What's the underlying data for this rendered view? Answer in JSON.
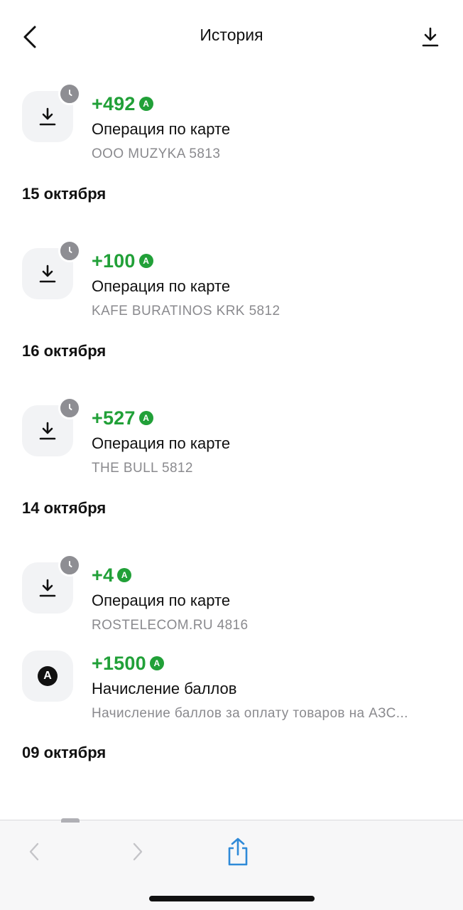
{
  "header": {
    "title": "История"
  },
  "transactions": [
    {
      "amount": "+492",
      "badge": "A",
      "title": "Операция по карте",
      "subtitle": "ООО MUZYKA 5813",
      "icon": "download-icon",
      "pending": true
    },
    {
      "date": "15 октября"
    },
    {
      "amount": "+100",
      "badge": "A",
      "title": "Операция по карте",
      "subtitle": "KAFE BURATINOS KRK 5812",
      "icon": "download-icon",
      "pending": true
    },
    {
      "date": "16 октября"
    },
    {
      "amount": "+527",
      "badge": "A",
      "title": "Операция по карте",
      "subtitle": "THE BULL 5812",
      "icon": "download-icon",
      "pending": true
    },
    {
      "date": "14 октября"
    },
    {
      "amount": "+4",
      "badge": "A",
      "title": "Операция по карте",
      "subtitle": "ROSTELECOM.RU 4816",
      "icon": "download-icon",
      "pending": true
    },
    {
      "amount": "+1500",
      "badge": "A",
      "title": "Начисление баллов",
      "subtitle": "Начисление баллов за оплату товаров на АЗС...",
      "icon": "points-icon",
      "pending": false
    },
    {
      "date": "09 октября"
    }
  ],
  "colors": {
    "accent_green": "#21a038",
    "muted_text": "#8a8a8e",
    "icon_bg": "#f2f3f5",
    "badge_gray": "#8e8e93",
    "share_blue": "#2f8ad8"
  }
}
